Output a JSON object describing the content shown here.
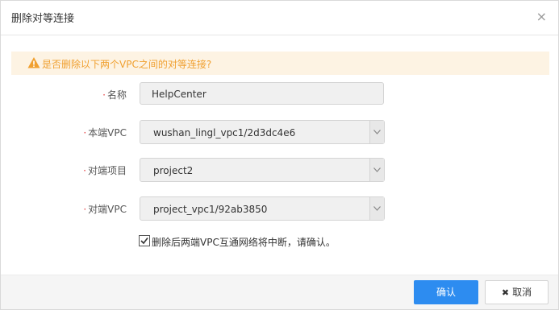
{
  "dialog": {
    "title": "删除对等连接",
    "close_glyph": "×"
  },
  "alert": {
    "icon": "warning-icon",
    "text": "是否删除以下两个VPC之间的对等连接?"
  },
  "form": {
    "name": {
      "label": "名称",
      "value": "HelpCenter"
    },
    "local_vpc": {
      "label": "本端VPC",
      "value": "wushan_lingl_vpc1/2d3dc4e6"
    },
    "peer_project": {
      "label": "对端项目",
      "value": "project2"
    },
    "peer_vpc": {
      "label": "对端VPC",
      "value": "project_vpc1/92ab3850"
    },
    "confirm_check": {
      "checked": true,
      "label": "删除后两端VPC互通网络将中断，请确认。"
    }
  },
  "footer": {
    "ok_label": "确认",
    "cancel_label": "取消",
    "cancel_glyph": "✖"
  },
  "colors": {
    "primary": "#2d8cf0",
    "warning_text": "#f0a030",
    "warning_bg": "#fdf3e3",
    "required": "#e4393c"
  }
}
